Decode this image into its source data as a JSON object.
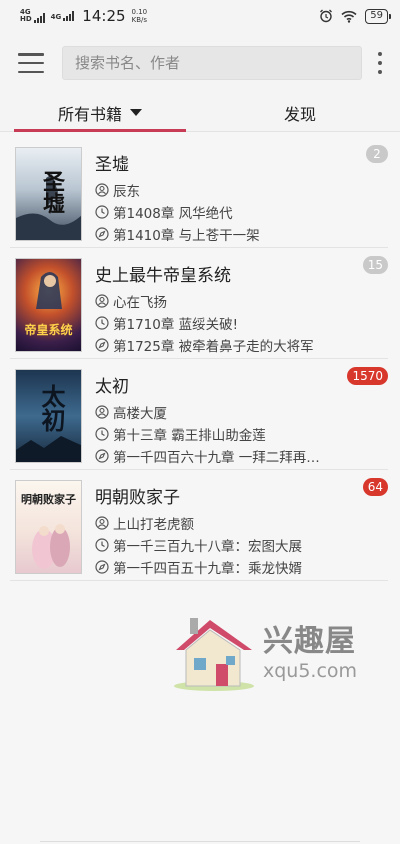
{
  "status": {
    "net1": "4G HD",
    "net2": "4G",
    "time": "14:25",
    "speed_value": "0.10",
    "speed_unit": "KB/s",
    "battery": "59"
  },
  "toolbar": {
    "search_placeholder": "搜索书名、作者"
  },
  "tabs": [
    {
      "label": "所有书籍",
      "active": true
    },
    {
      "label": "发现",
      "active": false
    }
  ],
  "books": [
    {
      "title": "圣墟",
      "author": "辰东",
      "last_read": "第1408章 风华绝代",
      "latest": "第1410章 与上苍干一架",
      "unread": "2",
      "badge_style": "grey",
      "cover_text": "圣墟"
    },
    {
      "title": "史上最牛帝皇系统",
      "author": "心在飞扬",
      "last_read": "第1710章 蓝绥关破!",
      "latest": "第1725章 被牵着鼻子走的大将军",
      "unread": "15",
      "badge_style": "grey",
      "cover_text": "帝皇系统"
    },
    {
      "title": "太初",
      "author": "高楼大厦",
      "last_read": "第十三章 霸王排山助金莲",
      "latest": "第一千四百六十九章 一拜二拜再…",
      "unread": "1570",
      "badge_style": "red",
      "cover_text": "太初"
    },
    {
      "title": "明朝败家子",
      "author": "上山打老虎额",
      "last_read": "第一千三百九十八章：宏图大展",
      "latest": "第一千四百五十九章：乘龙快婿",
      "unread": "64",
      "badge_style": "red",
      "cover_text": "明朝败家子"
    }
  ],
  "watermark": {
    "name": "兴趣屋",
    "url": "xqu5.com"
  },
  "colors": {
    "accent": "#c83b54",
    "badge_red": "#d8372c",
    "badge_grey": "#c9c9c9"
  }
}
